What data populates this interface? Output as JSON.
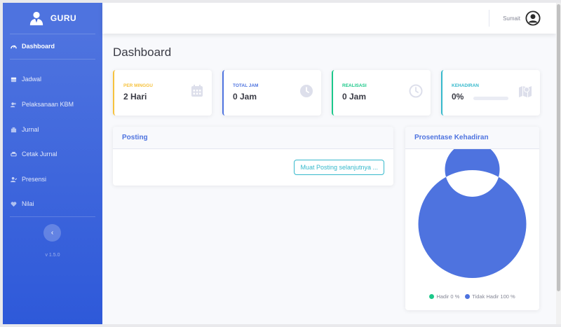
{
  "sidebar": {
    "brand": "GURU",
    "items": [
      {
        "label": "Dashboard",
        "icon": "tachometer-icon"
      },
      {
        "label": "Jadwal",
        "icon": "calendar-icon"
      },
      {
        "label": "Pelaksanaan KBM",
        "icon": "users-icon"
      },
      {
        "label": "Jurnal",
        "icon": "book-icon"
      },
      {
        "label": "Cetak Jurnal",
        "icon": "print-icon"
      },
      {
        "label": "Presensi",
        "icon": "user-check-icon"
      },
      {
        "label": "Nilai",
        "icon": "heart-icon"
      }
    ],
    "toggle_label": "‹",
    "version": "v 1.5.0"
  },
  "topbar": {
    "username": "Sumait"
  },
  "main": {
    "title": "Dashboard",
    "stats": [
      {
        "label": "PER MINGGU",
        "value": "2 Hari",
        "color": "#f6c23e",
        "icon": "calendar-icon"
      },
      {
        "label": "TOTAL JAM",
        "value": "0 Jam",
        "color": "#4e73df",
        "icon": "clock-icon"
      },
      {
        "label": "REALISASI",
        "value": "0 Jam",
        "color": "#1cc88a",
        "icon": "clock-icon"
      },
      {
        "label": "KEHADIRAN",
        "value": "0%",
        "color": "#36b9cc",
        "icon": "map-icon",
        "progress": 0
      }
    ],
    "posting": {
      "title": "Posting",
      "button": "Muat Posting selanjutnya ..."
    },
    "attendance": {
      "title": "Prosentase Kehadiran",
      "legend": [
        {
          "label": "Hadir 0 %",
          "color": "#1cc88a"
        },
        {
          "label": "Tidak Hadir 100 %",
          "color": "#4e73df"
        }
      ]
    }
  },
  "chart_data": {
    "type": "pie",
    "categories": [
      "Hadir",
      "Tidak Hadir"
    ],
    "values": [
      0,
      100
    ],
    "colors": [
      "#1cc88a",
      "#4e73df"
    ]
  }
}
